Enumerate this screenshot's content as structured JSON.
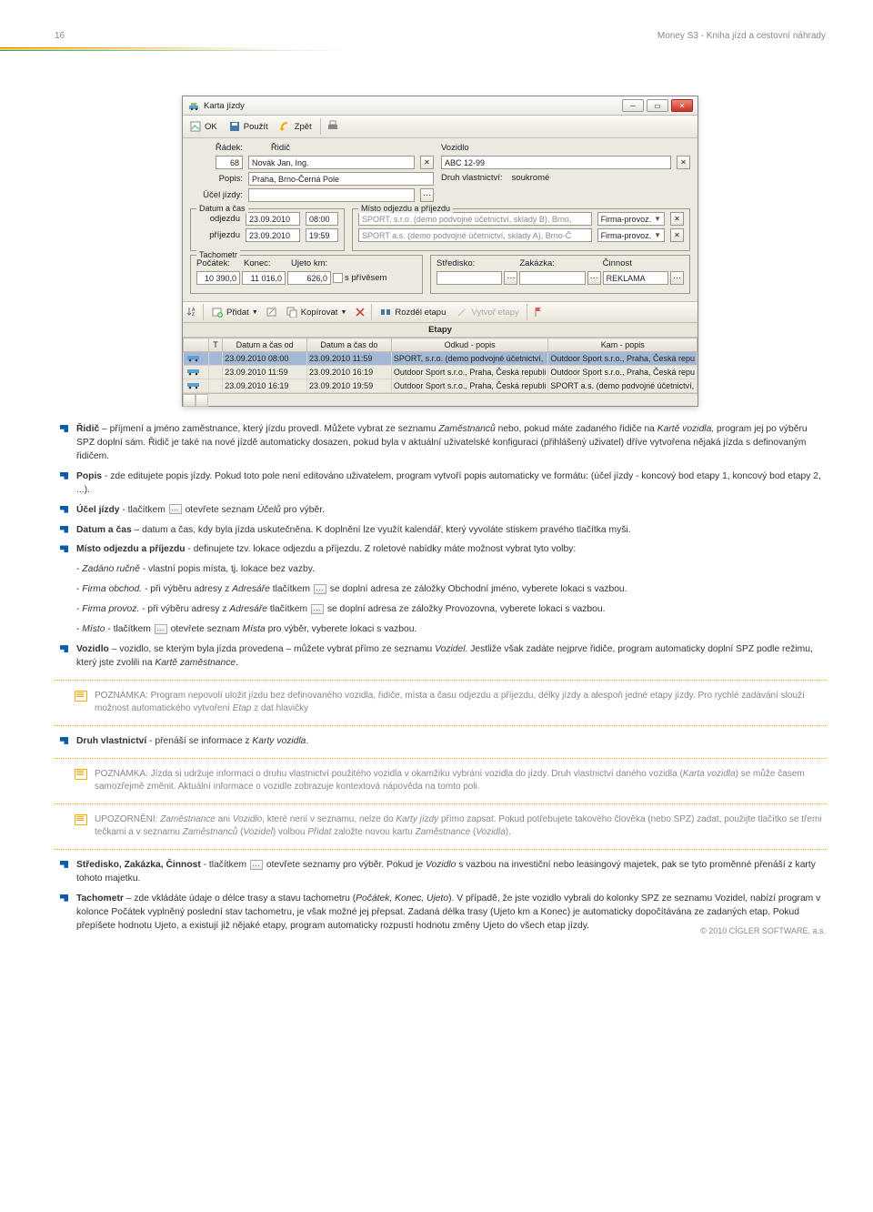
{
  "page": {
    "num": "16",
    "headerRight": "Money S3 - Kniha jízd a cestovní náhrady",
    "footer": "© 2010 CÍGLER SOFTWARE, a.s."
  },
  "app": {
    "title": "Karta jízdy",
    "tb": {
      "ok": "OK",
      "pouzit": "Použít",
      "zpet": "Zpět"
    },
    "fields": {
      "radekLbl": "Řádek:",
      "radekVal": "68",
      "ridicLbl": "Řidič",
      "ridic": "Novák Jan, Ing.",
      "vozidloLbl": "Vozidlo",
      "vozidlo": "ABC 12-99",
      "popisLbl": "Popis:",
      "popis": "Praha, Brno-Černá Pole",
      "ucelLbl": "Účel jízdy:",
      "ucel": "",
      "druhLbl": "Druh vlastnictví:",
      "druh": "soukromé"
    },
    "grpDatum": {
      "legend": "Datum a čas",
      "odjLbl": "odjezdu",
      "odDate": "23.09.2010",
      "odTime": "08:00",
      "priLbl": "příjezdu",
      "priDate": "23.09.2010",
      "priTime": "19:59"
    },
    "grpMisto": {
      "legend": "Místo odjezdu a příjezdu",
      "od": "SPORT, s.r.o. (demo podvojné účetnictví, sklady B), Brno,",
      "pri": "SPORT a.s. (demo podvojné účetnictví, sklady A), Brno-Č",
      "comboText": "Firma-provoz."
    },
    "grpTach": {
      "legend": "Tachometr",
      "pocLbl": "Počátek:",
      "poc": "10 390,0",
      "konLbl": "Konec:",
      "kon": "11 016,0",
      "ujLbl": "Ujeto km:",
      "uj": "626,0",
      "privesLbl": "s přívěsem"
    },
    "grpSZC": {
      "stLbl": "Středisko:",
      "zaLbl": "Zakázka:",
      "cinLbl": "Činnost",
      "cin": "REKLAMA"
    },
    "gridtb": {
      "pridat": "Přidat",
      "kopirovat": "Kopírovat",
      "rozdel": "Rozděl etapu",
      "vytvor": "Vytvoř etapy"
    },
    "grid": {
      "title": "Etapy",
      "cols": {
        "t": "T",
        "od": "Datum a čas od",
        "do": "Datum a čas do",
        "odkud": "Odkud - popis",
        "kam": "Kam - popis"
      },
      "rows": [
        {
          "od": "23.09.2010 08:00",
          "do": "23.09.2010 11:59",
          "odkud": "SPORT, s.r.o. (demo podvojné účetnictví,",
          "kam": "Outdoor Sport s.r.o., Praha, Česká repu"
        },
        {
          "od": "23.09.2010 11:59",
          "do": "23.09.2010 16:19",
          "odkud": "Outdoor Sport s.r.o., Praha, Česká republi",
          "kam": "Outdoor Sport s.r.o., Praha, Česká repu"
        },
        {
          "od": "23.09.2010 16:19",
          "do": "23.09.2010 19:59",
          "odkud": "Outdoor Sport s.r.o., Praha, Česká republi",
          "kam": "SPORT a.s. (demo podvojné účetnictví,"
        }
      ]
    }
  },
  "body": {
    "b1a": "Řidič",
    "b1b": " – příjmení a jméno zaměstnance, který jízdu provedl. Můžete vybrat ze seznamu ",
    "b1c": "Zaměstnanců",
    "b1d": " nebo, pokud máte zadaného řidiče na ",
    "b1e": "Kartě vozidla,",
    "b1f": " program jej po výběru SPZ doplní sám. Řidič je také na nové jízdě automaticky dosazen, pokud byla v aktuální uživatelské konfiguraci (přihlášený uživatel) dříve vytvořena nějaká jízda s definovaným řidičem.",
    "b2a": "Popis",
    "b2b": " - zde editujete popis jízdy. Pokud toto pole není editováno uživatelem, program vytvoří popis automaticky ve formátu: (účel jízdy - koncový bod etapy 1, koncový bod etapy 2, ...).",
    "b3a": "Účel jízdy",
    "b3b": " - tlačítkem ",
    "b3c": " otevřete seznam ",
    "b3d": "Účelů",
    "b3e": " pro výběr.",
    "b4a": "Datum a čas",
    "b4b": " – datum a čas, kdy byla jízda uskutečněna. K doplnění lze využít kalendář, který vyvoláte stiskem pravého tlačítka myši.",
    "b5a": "Místo odjezdu a příjezdu",
    "b5b": " - definujete tzv. lokace odjezdu a příjezdu. Z roletové nabídky máte možnost vybrat tyto volby:",
    "sub1a": "- ",
    "sub1b": "Zadáno ručně",
    "sub1c": " - vlastní popis místa, tj. lokace bez vazby.",
    "sub2a": "- ",
    "sub2b": "Firma obchod.",
    "sub2c": " - při výběru adresy z ",
    "sub2d": "Adresáře",
    "sub2e": " tlačítkem ",
    "sub2f": " se doplní adresa ze záložky Obchodní jméno, vyberete lokaci s vazbou.",
    "sub3a": "- ",
    "sub3b": "Firma provoz.",
    "sub3c": " -  při výběru adresy z ",
    "sub3d": "Adresáře",
    "sub3e": "  tlačítkem ",
    "sub3f": " se doplní adresa ze záložky Provozovna, vyberete lokaci s vazbou.",
    "sub4a": "- ",
    "sub4b": "Místo",
    "sub4c": " -  tlačítkem ",
    "sub4d": " otevřete seznam ",
    "sub4e": "Místa",
    "sub4f": " pro výběr, vyberete lokaci s vazbou.",
    "b6a": "Vozidlo",
    "b6b": " – vozidlo, se kterým byla jízda provedena – můžete vybrat přímo ze seznamu ",
    "b6c": "Vozidel",
    "b6d": ". Jestliže však  zadáte nejprve řidiče, program automaticky doplní SPZ podle režimu, který jste zvolili na ",
    "b6e": "Kartě zaměstnance",
    "b6f": ".",
    "note1a": "POZNÁMKA: Program nepovolí uložit jízdu bez definovaného vozidla, řidiče, místa a času odjezdu a příjezdu, délky jízdy a alespoň jedné etapy jízdy. Pro rychlé zadávání slouží možnost automatického vytvoření ",
    "note1b": "Etap",
    "note1c": " z dat hlavičky",
    "b7a": "Druh vlastnictví",
    "b7b": " - přenáší se informace z ",
    "b7c": "Karty vozidla",
    "b7d": ".",
    "note2a": "POZNÁMKA: Jízda si udržuje informaci o druhu vlastnictví použitého vozidla v okamžiku vybrání vozidla do jízdy. Druh vlastnictví daného vozidla (",
    "note2b": "Karta vozidla",
    "note2c": ") se může časem samozřejmě změnit. Aktuální informace o vozidle zobrazuje kontextová nápověda na tomto poli.",
    "note3a": "UPOZORNĚNÍ: ",
    "note3b": "Zaměstnance",
    "note3c": " ani ",
    "note3d": "Vozidlo",
    "note3e": ", které není v seznamu, nelze do ",
    "note3f": "Karty jízdy",
    "note3g": " přímo zapsat. Pokud potřebujete takového člověka (nebo SPZ) zadat, použijte tlačítko se třemi tečkami a v seznamu ",
    "note3h": "Zaměstnanců",
    "note3i": " (",
    "note3j": "Vozidel",
    "note3k": ") volbou ",
    "note3l": "Přidat",
    "note3m": " založte novou kartu ",
    "note3n": "Zaměstnance",
    "note3o": " (",
    "note3p": "Vozidla",
    "note3q": ").",
    "b8a": "Středisko, Zakázka, Činnost",
    "b8b": " - tlačítkem ",
    "b8c": " otevřete seznamy pro výběr. Pokud je ",
    "b8d": "Vozidlo",
    "b8e": " s vazbou na investiční nebo leasingový majetek, pak se tyto proměnné přenáší z karty tohoto majetku.",
    "b9a": "Tachometr",
    "b9b": " – zde vkládáte údaje o délce trasy a stavu tachometru (",
    "b9c": "Počátek, Konec, Ujeto",
    "b9d": "). V případě, že jste vozidlo vybrali do kolonky SPZ ze seznamu Vozidel, nabízí program v kolonce Počátek vyplněný poslední stav tachometru, je však možné jej přepsat. Zadaná délka trasy (Ujeto km a Konec) je automaticky dopočítávána ze zadaných etap. Pokud přepíšete hodnotu Ujeto, a existují již nějaké etapy, program automaticky rozpustí hodnotu změny Ujeto do všech etap jízdy."
  }
}
